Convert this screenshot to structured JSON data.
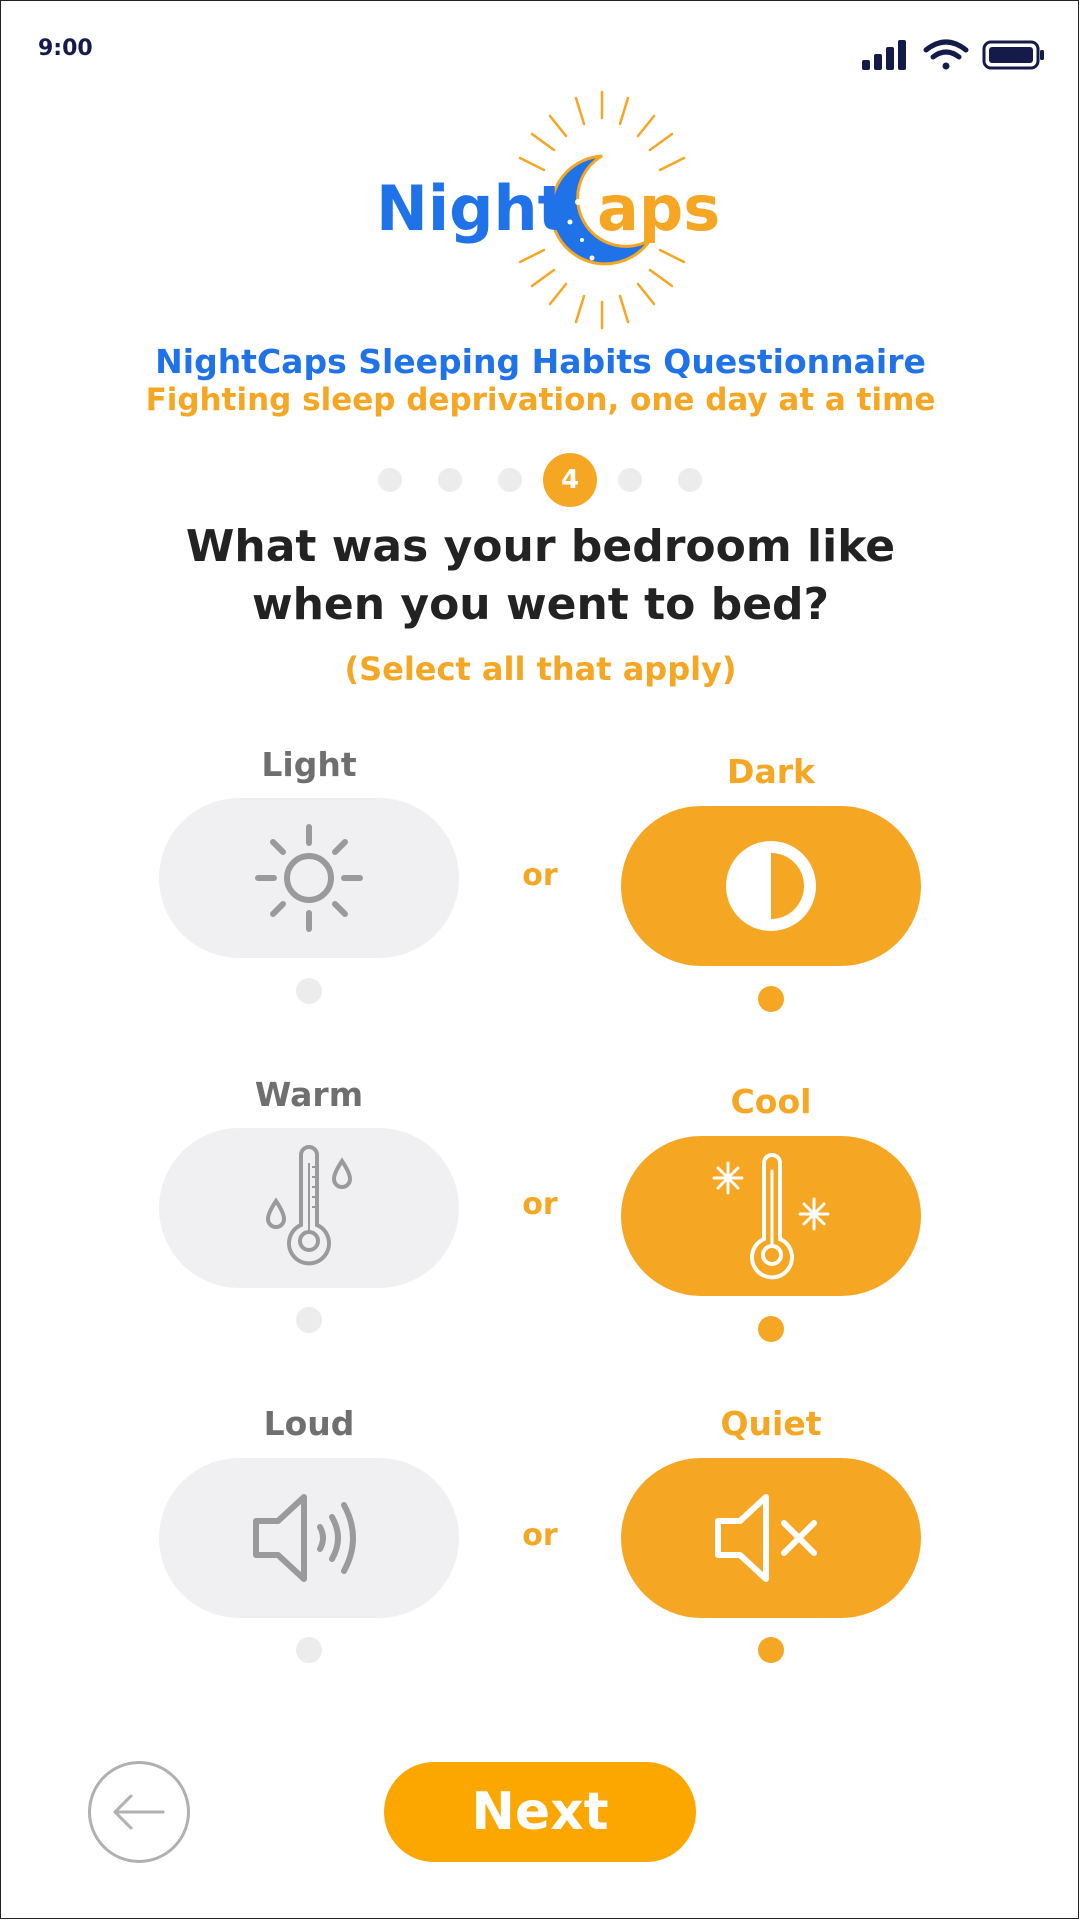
{
  "status": {
    "time": "9:00",
    "icons": [
      "signal-icon",
      "wifi-icon",
      "battery-icon"
    ]
  },
  "logo": {
    "part1": "Night",
    "part2": "aps",
    "icon": "crescent-moon-c-icon"
  },
  "header": {
    "title": "NightCaps Sleeping Habits Questionnaire",
    "tagline": "Fighting sleep deprivation, one day at a time"
  },
  "progress": {
    "current_step": "4",
    "total_steps": 6
  },
  "question": {
    "line1": "What was your bedroom like",
    "line2": "when you went to bed?",
    "hint": "(Select all that apply)"
  },
  "options": [
    {
      "left": {
        "label": "Light",
        "icon": "sun-icon",
        "selected": false
      },
      "separator": "or",
      "right": {
        "label": "Dark",
        "icon": "half-circle-contrast-icon",
        "selected": true
      }
    },
    {
      "left": {
        "label": "Warm",
        "icon": "thermometer-drops-icon",
        "selected": false
      },
      "separator": "or",
      "right": {
        "label": "Cool",
        "icon": "thermometer-snowflake-icon",
        "selected": true
      }
    },
    {
      "left": {
        "label": "Loud",
        "icon": "speaker-sound-icon",
        "selected": false
      },
      "separator": "or",
      "right": {
        "label": "Quiet",
        "icon": "speaker-mute-icon",
        "selected": true
      }
    }
  ],
  "navigation": {
    "back_icon": "arrow-left-icon",
    "next_label": "Next"
  },
  "colors": {
    "primary_blue": "#1f72e8",
    "accent_orange": "#f5a623",
    "inactive_gray": "#f0f0f2",
    "dark_navy": "#141a4a"
  }
}
